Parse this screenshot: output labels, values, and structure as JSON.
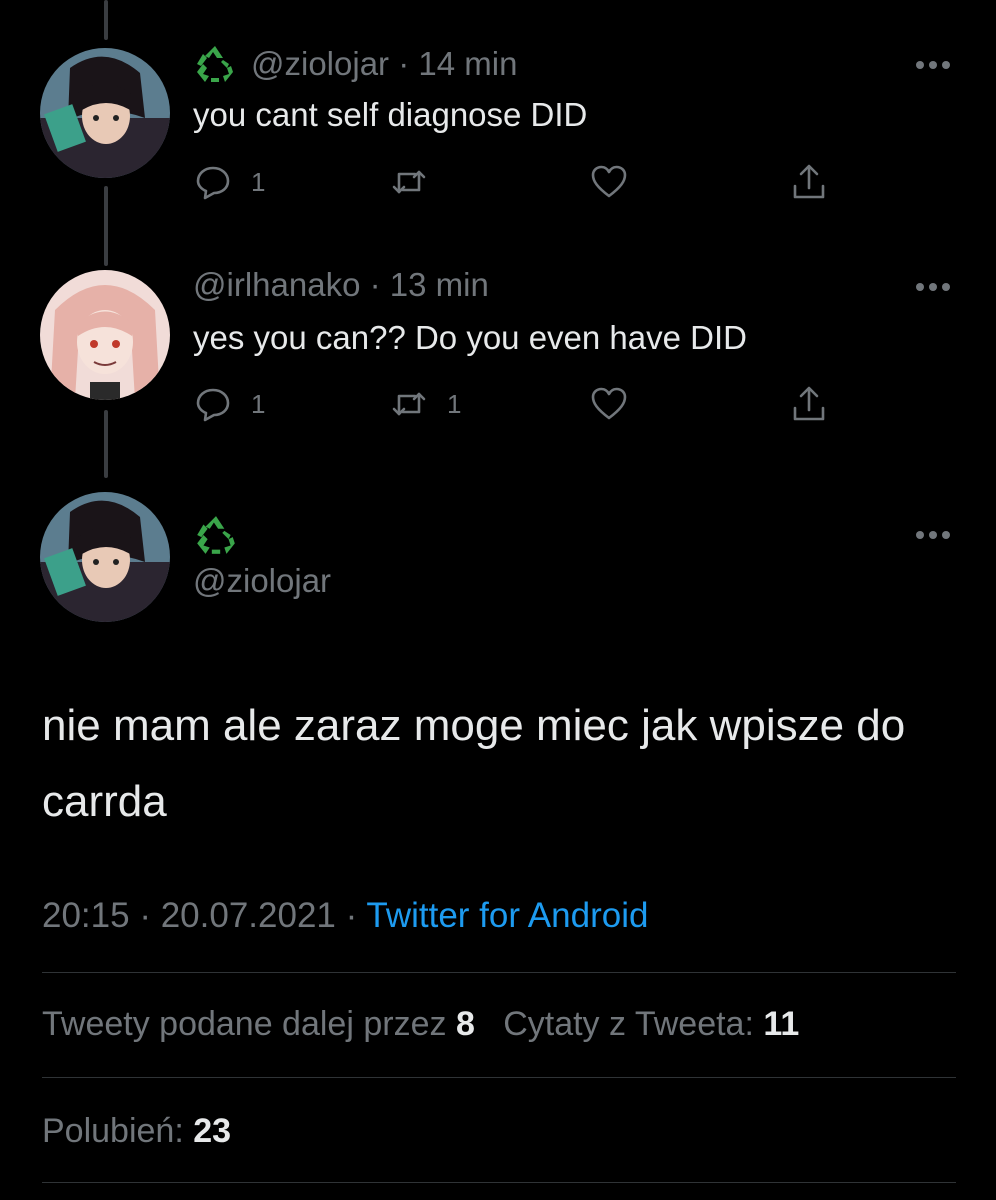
{
  "tweets": [
    {
      "handle": "@ziolojar",
      "time": "14 min",
      "name_icon": "recycle-icon",
      "text": "you cant self diagnose DID",
      "reply_count": "1",
      "retweet_count": "",
      "avatar": "anime-boy-avatar"
    },
    {
      "handle": "@irlhanako",
      "time": "13 min",
      "text": "yes you can?? Do you even have DID",
      "reply_count": "1",
      "retweet_count": "1",
      "avatar": "anime-girl-avatar"
    }
  ],
  "main_tweet": {
    "name_icon": "recycle-icon",
    "handle": "@ziolojar",
    "text": "nie mam ale zaraz moge miec jak wpisze do carrda",
    "time": "20:15",
    "date": "20.07.2021",
    "source": "Twitter for Android",
    "separator": "·"
  },
  "stats": {
    "retweets_label": "Tweety podane dalej przez",
    "retweets_value": "8",
    "quotes_label": "Cytaty z Tweeta:",
    "quotes_value": "11",
    "likes_label": "Polubień:",
    "likes_value": "23"
  },
  "colors": {
    "background": "#000000",
    "text": "#e7e9ea",
    "secondary": "#71767b",
    "link": "#1d9bf0",
    "recycle_green": "#3aa54a"
  }
}
